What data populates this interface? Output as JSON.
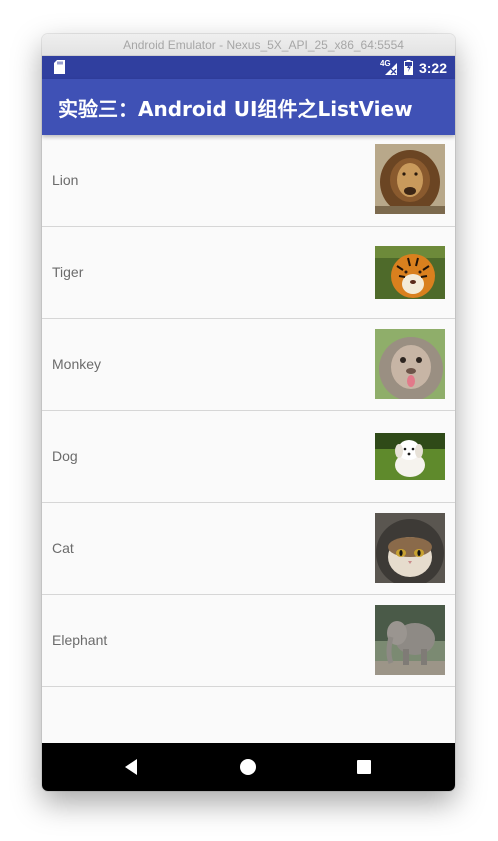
{
  "window": {
    "title": "Android Emulator - Nexus_5X_API_25_x86_64:5554"
  },
  "status_bar": {
    "network": "4G",
    "time": "3:22"
  },
  "app_bar": {
    "title": "实验三：Android UI组件之ListView"
  },
  "list": {
    "items": [
      {
        "label": "Lion",
        "image": "lion-photo"
      },
      {
        "label": "Tiger",
        "image": "tiger-photo"
      },
      {
        "label": "Monkey",
        "image": "monkey-photo"
      },
      {
        "label": "Dog",
        "image": "dog-photo"
      },
      {
        "label": "Cat",
        "image": "cat-photo"
      },
      {
        "label": "Elephant",
        "image": "elephant-photo"
      }
    ]
  },
  "nav_bar": {
    "buttons": [
      "back-icon",
      "home-icon",
      "recents-icon"
    ]
  },
  "colors": {
    "status_bar": "#303f9f",
    "app_bar": "#3f51b5",
    "list_background": "#fafafa",
    "divider": "#d6d6d6",
    "nav_bar": "#000000"
  }
}
